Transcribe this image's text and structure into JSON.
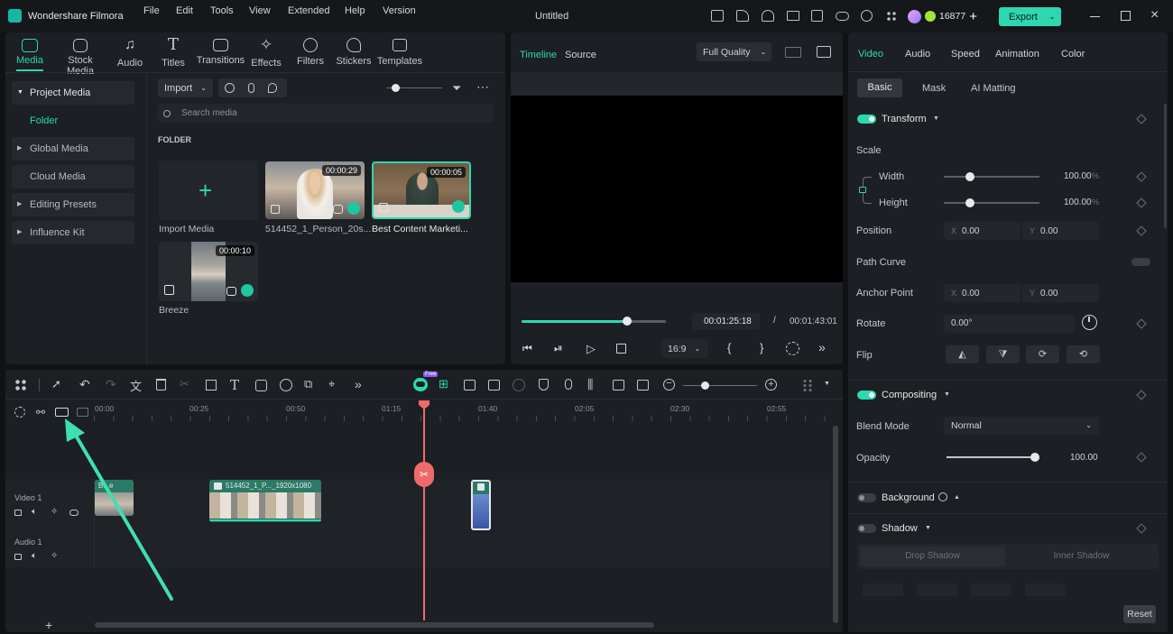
{
  "app": {
    "name": "Wondershare Filmora",
    "doc_title": "Untitled",
    "credits": "16877",
    "export_label": "Export"
  },
  "menu": [
    "File",
    "Edit",
    "Tools",
    "View",
    "Extended",
    "Help",
    "Version"
  ],
  "nav_tabs": [
    "Media",
    "Stock Media",
    "Audio",
    "Titles",
    "Transitions",
    "Effects",
    "Filters",
    "Stickers",
    "Templates"
  ],
  "sidebar": [
    "Project Media",
    "Folder",
    "Global Media",
    "Cloud Media",
    "Editing Presets",
    "Influence Kit"
  ],
  "media_toolbar": {
    "import_label": "Import",
    "search_placeholder": "Search media",
    "folder_label": "FOLDER"
  },
  "media_items": [
    {
      "caption": "Import Media",
      "duration": ""
    },
    {
      "caption": "514452_1_Person_20s...",
      "duration": "00:00:29"
    },
    {
      "caption": "Best Content Marketi...",
      "duration": "00:00:05"
    },
    {
      "caption": "Breeze",
      "duration": "00:00:10"
    }
  ],
  "preview": {
    "tab_timeline": "Timeline",
    "tab_source": "Source",
    "quality": "Full Quality",
    "current_time": "00:01:25:18",
    "separator": "/",
    "total_time": "00:01:43:01",
    "aspect": "16:9",
    "progress": 0.73
  },
  "inspector": {
    "tabs": [
      "Video",
      "Audio",
      "Speed",
      "Animation",
      "Color"
    ],
    "subtabs": [
      "Basic",
      "Mask",
      "AI Matting"
    ],
    "transform": "Transform",
    "scale": "Scale",
    "width_label": "Width",
    "width_value": "100.00",
    "width_unit": "%",
    "height_label": "Height",
    "height_value": "100.00",
    "height_unit": "%",
    "position_label": "Position",
    "pos_x_label": "X",
    "pos_x": "0.00",
    "pos_y_label": "Y",
    "pos_y": "0.00",
    "path_curve": "Path Curve",
    "anchor_label": "Anchor Point",
    "anchor_x_label": "X",
    "anchor_x": "0.00",
    "anchor_y_label": "Y",
    "anchor_y": "0.00",
    "rotate_label": "Rotate",
    "rotate_value": "0.00°",
    "flip_label": "Flip",
    "compositing": "Compositing",
    "blend_label": "Blend Mode",
    "blend_value": "Normal",
    "opacity_label": "Opacity",
    "opacity_value": "100.00",
    "background": "Background",
    "shadow": "Shadow",
    "drop_shadow": "Drop Shadow",
    "inner_shadow": "Inner Shadow",
    "reset": "Reset"
  },
  "timeline": {
    "ruler": [
      "00:00",
      "00:25",
      "00:50",
      "01:15",
      "01:40",
      "02:05",
      "02:30",
      "02:55"
    ],
    "video_track": "Video 1",
    "audio_track": "Audio 1",
    "clip1_label": "B...e",
    "clip2_label": "514452_1_P..._1920x1080",
    "ai_badge": "Free"
  },
  "colors": {
    "accent": "#2fd7b0",
    "playhead": "#f06a6a",
    "arrow": "#3fe0b0"
  }
}
